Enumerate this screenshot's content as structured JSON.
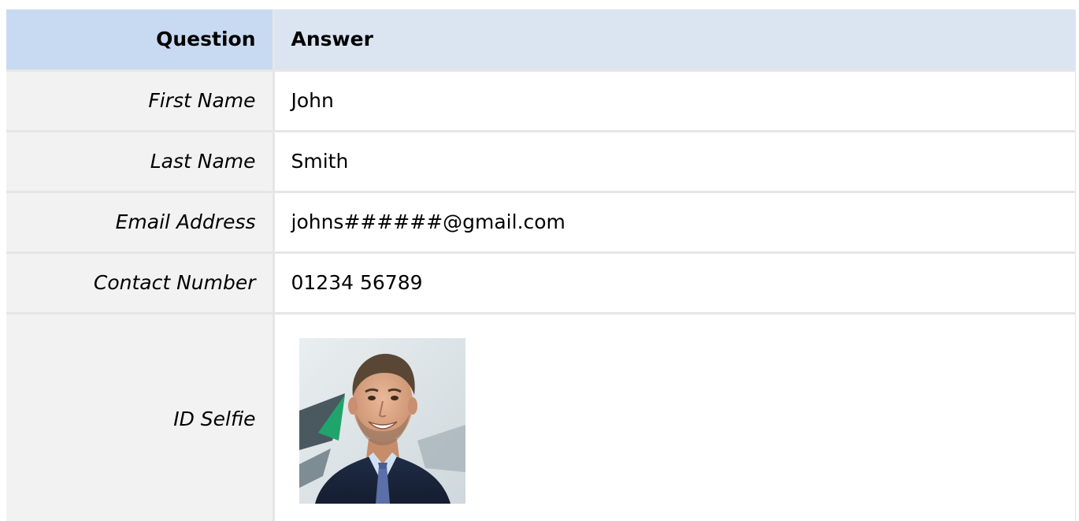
{
  "table": {
    "headers": {
      "question": "Question",
      "answer": "Answer"
    },
    "rows": [
      {
        "question": "First Name",
        "answer": "John"
      },
      {
        "question": "Last Name",
        "answer": "Smith"
      },
      {
        "question": "Email Address",
        "answer": "johns######@gmail.com"
      },
      {
        "question": "Contact Number",
        "answer": "01234 56789"
      },
      {
        "question": "ID Selfie",
        "answer_image": "selfie-photo"
      }
    ]
  },
  "colors": {
    "question_header_bg": "#c8daf1",
    "answer_header_bg": "#dbe4f1",
    "question_cell_bg": "#f2f2f2",
    "grid_line": "#e6e6e6"
  }
}
